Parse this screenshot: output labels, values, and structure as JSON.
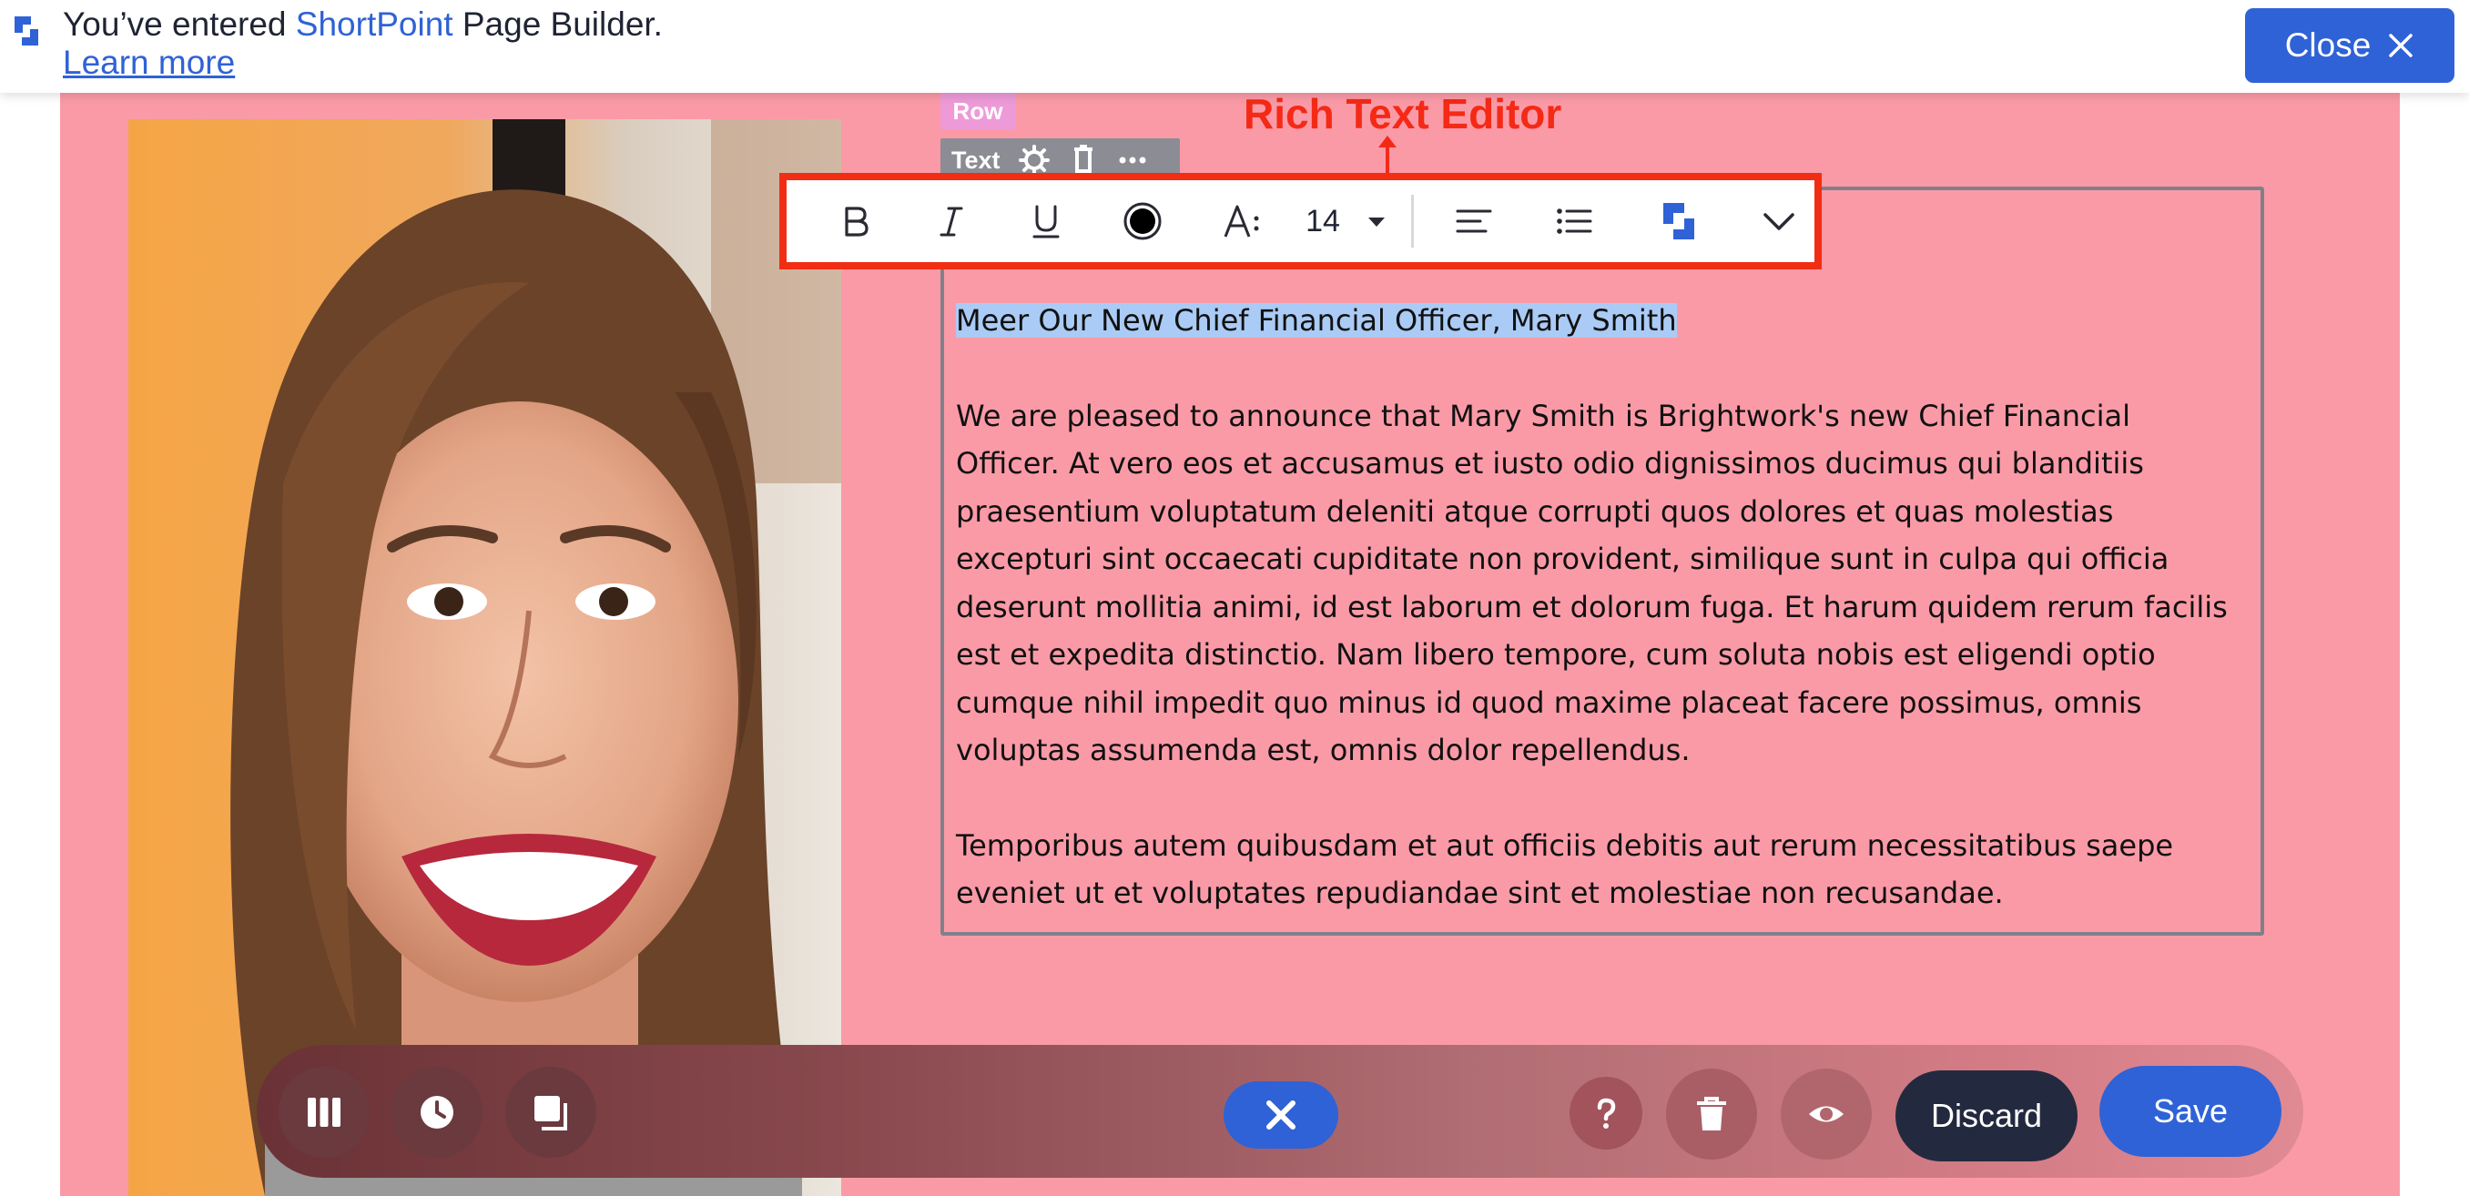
{
  "banner": {
    "text_prefix": "You’ve entered ",
    "brand": "ShortPoint",
    "text_suffix": " Page Builder. ",
    "learn_more": "Learn more",
    "close_label": "Close",
    "logo_icon": "shortpoint-logo-icon",
    "close_icon": "close-icon"
  },
  "labels": {
    "row": "Row",
    "text": "Text",
    "annotation": "Rich Text Editor"
  },
  "toolbar": {
    "font_size": "14",
    "icons": [
      "bold-icon",
      "italic-icon",
      "underline-icon",
      "text-color-icon",
      "font-style-icon",
      "chevron-down-icon",
      "align-left-icon",
      "bullet-list-icon",
      "shortpoint-logo-icon",
      "chevron-down-icon"
    ]
  },
  "editor": {
    "heading": "Meer Our New Chief Financial Officer, Mary Smith",
    "paragraph1": "We are pleased to announce that Mary Smith is Brightwork's new Chief Financial Officer. At vero eos et accusamus et iusto odio dignissimos ducimus qui blanditiis praesentium voluptatum deleniti atque corrupti quos dolores et quas molestias excepturi sint occaecati cupiditate non provident, similique sunt in culpa qui officia deserunt mollitia animi, id est laborum et dolorum fuga. Et harum quidem rerum facilis est et expedita distinctio. Nam libero tempore, cum soluta nobis est eligendi optio cumque nihil impedit quo minus id quod maxime placeat facere possimus, omnis voluptas assumenda est, omnis dolor repellendus.",
    "paragraph2": "Temporibus autem quibusdam et aut officiis debitis aut rerum necessitatibus saepe eveniet ut et voluptates repudiandae sint et molestiae non recusandae."
  },
  "bottombar": {
    "discard_label": "Discard",
    "save_label": "Save",
    "icons": [
      "columns-icon",
      "history-icon",
      "layers-icon",
      "close-icon",
      "help-icon",
      "trash-icon",
      "preview-eye-icon"
    ]
  },
  "colors": {
    "accent": "#2f62d6",
    "page_background": "#fb9aa7",
    "annotation": "#f42a16",
    "selection": "#aacbf5",
    "discard_button": "#232a3f"
  }
}
